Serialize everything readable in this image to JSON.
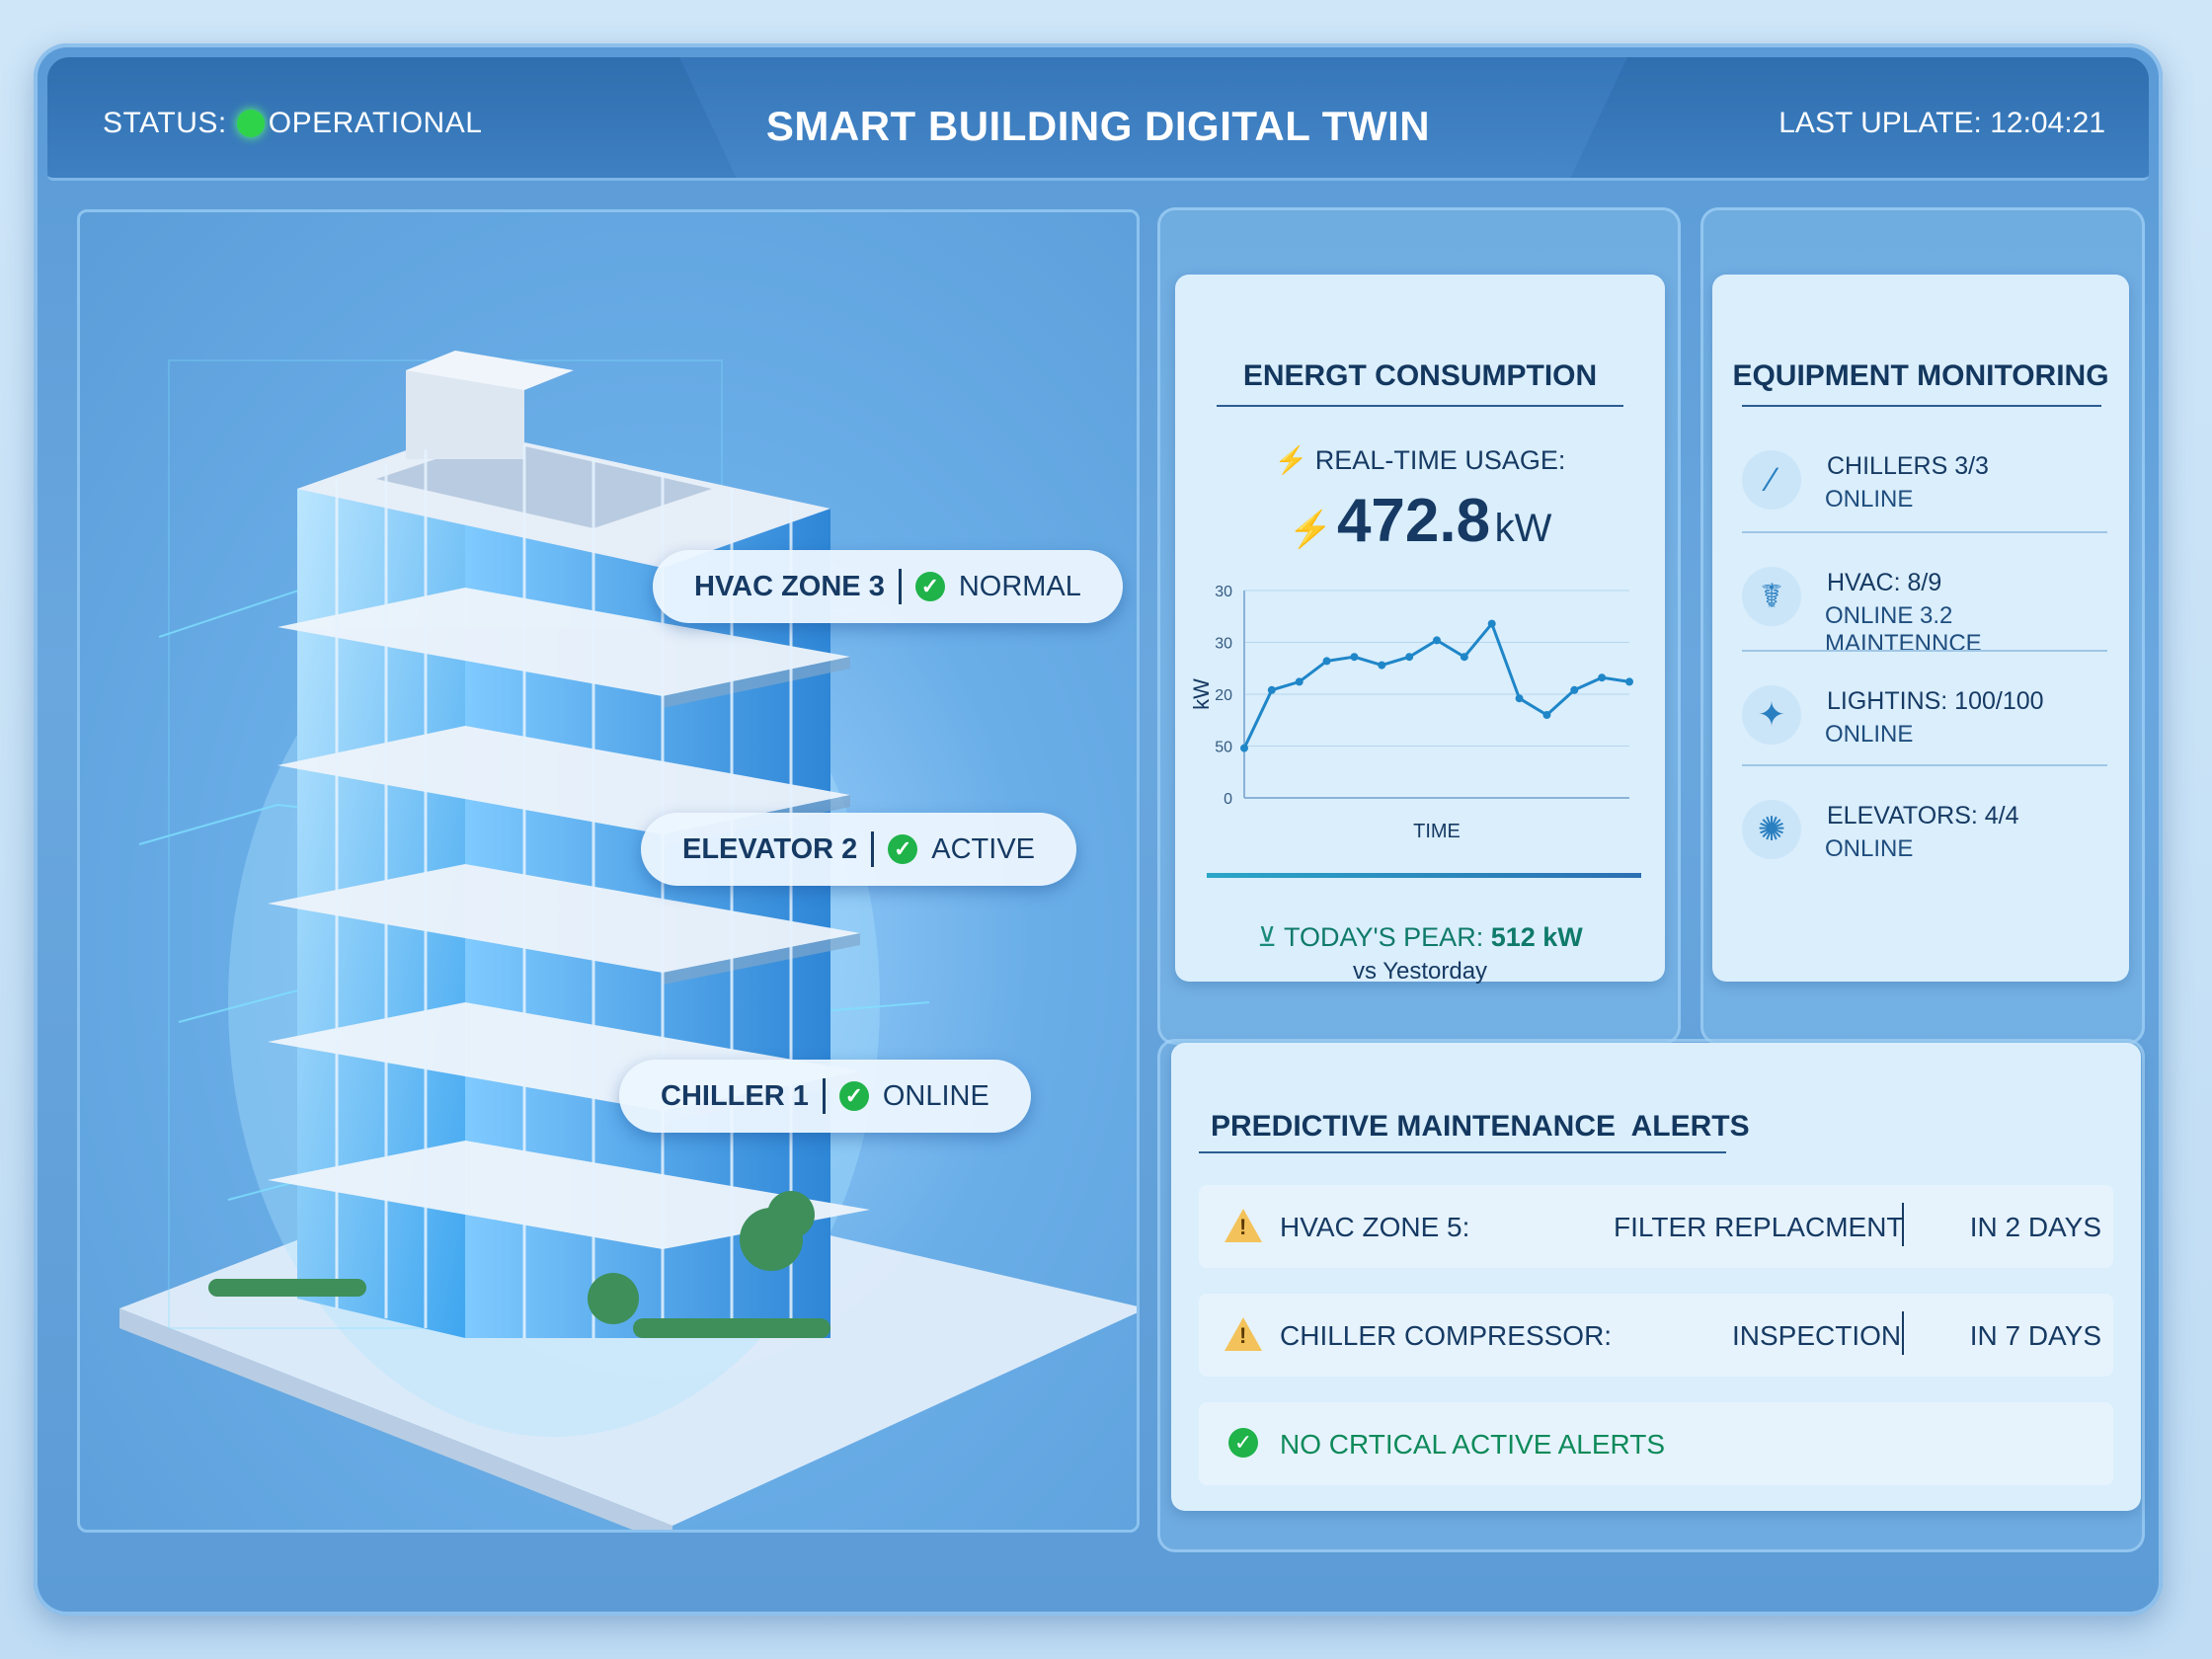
{
  "header": {
    "status_label": "STATUS:",
    "status_value": "OPERATIONAL",
    "status_color": "#2fd34a",
    "title": "SMART BUILDING DIGITAL TWIN",
    "last_update": "LAST UPLATE: 12:04:21"
  },
  "scene": {
    "tags": [
      {
        "name": "HVAC ZONE 3",
        "state": "NORMAL"
      },
      {
        "name": "ELEVATOR 2",
        "state": "ACTIVE"
      },
      {
        "name": "CHILLER 1",
        "state": "ONLINE"
      }
    ]
  },
  "energy": {
    "title": "ENERGT CONSUMPTION",
    "realtime_label": "REAL-TIME USAGE:",
    "realtime_value": "472.8",
    "realtime_unit": "kW",
    "peak_label": "TODAY'S PEAR:",
    "peak_value": "512 kW",
    "peak_sub": "vs Yestorday"
  },
  "chart_data": {
    "type": "line",
    "xlabel": "TIME",
    "ylabel": "kW",
    "yticks": [
      "0",
      "50",
      "20",
      "30",
      "30"
    ],
    "x": [
      0,
      1,
      2,
      3,
      4,
      5,
      6,
      7,
      8,
      9,
      10,
      11,
      12,
      13,
      14
    ],
    "series": [
      {
        "values": [
          6,
          13,
          14,
          16.5,
          17,
          16,
          17,
          19,
          17,
          21,
          12,
          10,
          13,
          14.5,
          14
        ]
      }
    ],
    "line_color": "#1f86c8"
  },
  "equipment": {
    "title": "EQUIPMENT MONITORING",
    "items": [
      {
        "name": "CHILLERS 3/3",
        "sub": "ONLINE",
        "icon": "chiller-icon"
      },
      {
        "name": "HVAC: 8/9",
        "sub": "ONLINE  3.2  MAINTENNCE",
        "icon": "hvac-icon"
      },
      {
        "name": "LIGHTINS: 100/100",
        "sub": "ONLINE",
        "icon": "lighting-icon"
      },
      {
        "name": "ELEVATORS: 4/4",
        "sub": "ONLINE",
        "icon": "elevator-icon"
      }
    ]
  },
  "alerts": {
    "title": "PREDICTIVE MAINTENANCE  ALERTS",
    "rows": [
      {
        "asset": "HVAC ZONE 5:",
        "task": "FILTER REPLACMENT",
        "due": "IN 2 DAYS"
      },
      {
        "asset": "CHILLER COMPRESSOR:",
        "task": "INSPECTION",
        "due": "IN 7 DAYS"
      }
    ],
    "ok_text": "NO CRTICAL ACTIVE ALERTS"
  }
}
